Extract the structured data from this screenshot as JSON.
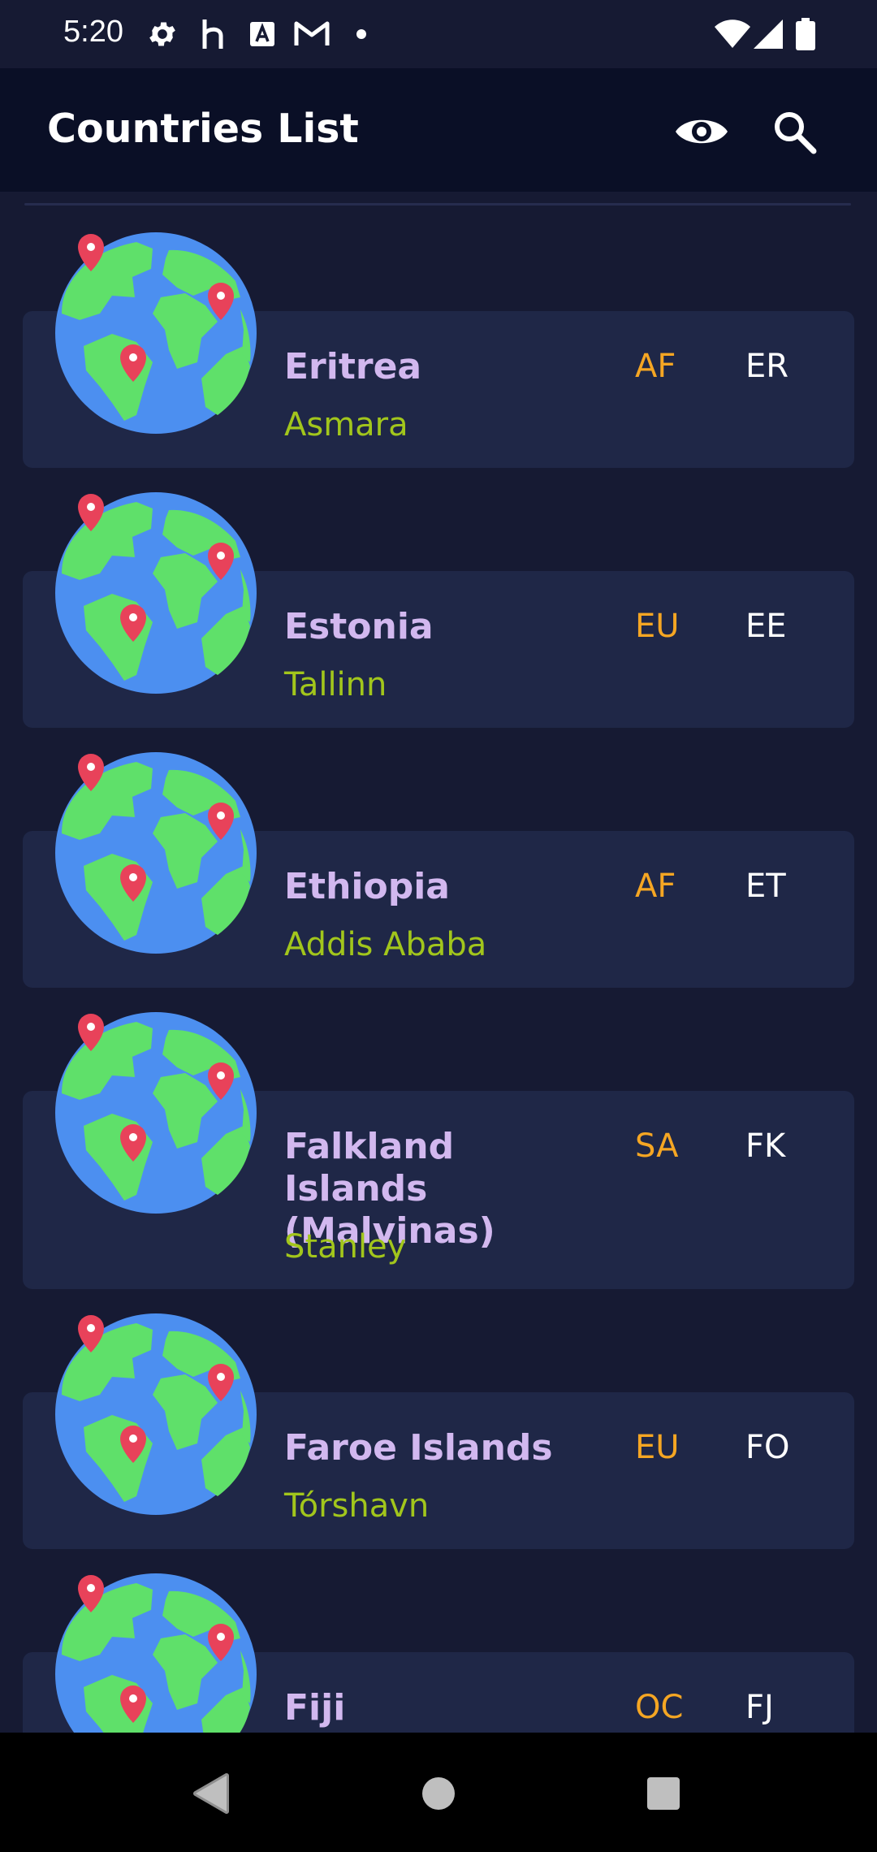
{
  "status_bar": {
    "time": "5:20",
    "icons": [
      "gear-icon",
      "h-app-icon",
      "a-app-icon",
      "gmail-icon",
      "dot-icon",
      "wifi-icon",
      "signal-icon",
      "battery-icon"
    ]
  },
  "app_bar": {
    "title": "Countries List",
    "actions": [
      "eye-icon",
      "search-icon"
    ]
  },
  "countries": [
    {
      "name": "Eritrea",
      "capital": "Asmara",
      "region": "AF",
      "code": "ER"
    },
    {
      "name": "Estonia",
      "capital": "Tallinn",
      "region": "EU",
      "code": "EE"
    },
    {
      "name": "Ethiopia",
      "capital": "Addis Ababa",
      "region": "AF",
      "code": "ET"
    },
    {
      "name": "Falkland Islands (Malvinas)",
      "capital": "Stanley",
      "region": "SA",
      "code": "FK"
    },
    {
      "name": "Faroe Islands",
      "capital": "Tórshavn",
      "region": "EU",
      "code": "FO"
    },
    {
      "name": "Fiji",
      "capital": "",
      "region": "OC",
      "code": "FJ"
    }
  ],
  "colors": {
    "background": "#161a33",
    "app_bar": "#0a0f26",
    "card": "#1f2747",
    "name": "#d2b8ef",
    "capital": "#a2c61c",
    "region": "#f5a623",
    "code": "#ffffff"
  },
  "nav_bar": [
    "back-icon",
    "home-icon",
    "recents-icon"
  ]
}
